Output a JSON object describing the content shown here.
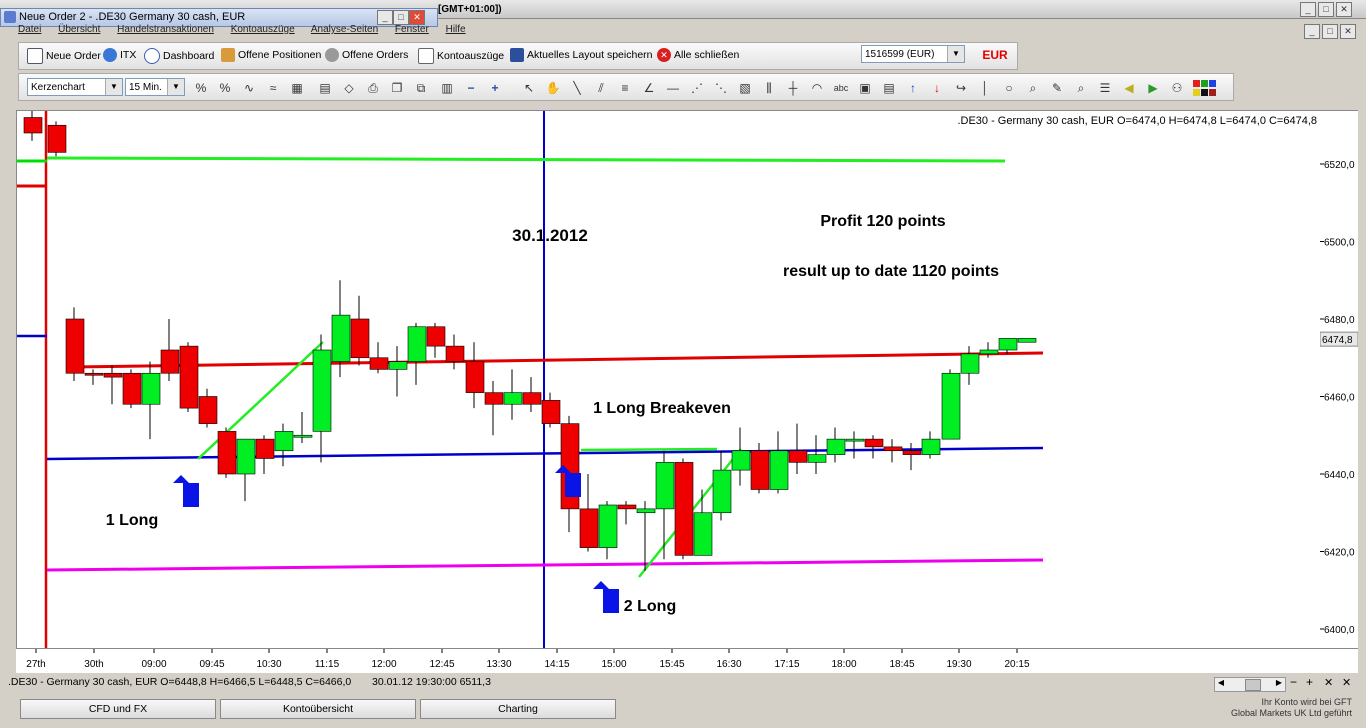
{
  "window": {
    "inner_title": "Neue Order 2 - .DE30 Germany 30 cash, EUR",
    "gmt": "[GMT+01:00])"
  },
  "menu": [
    "Datei",
    "Übersicht",
    "Handelstransaktionen",
    "Kontoauszüge",
    "Analyse-Seiten",
    "Fenster",
    "Hilfe"
  ],
  "toolbar": {
    "new_order": "Neue Order",
    "itx": "ITX",
    "dashboard": "Dashboard",
    "open_positions": "Offene Positionen",
    "open_orders": "Offene Orders",
    "statements": "Kontoauszüge",
    "save_layout": "Aktuelles Layout speichern",
    "close_all": "Alle schließen",
    "account": "1516599 (EUR)",
    "currency": "EUR"
  },
  "chart_toolbar": {
    "chart_type": "Kerzenchart",
    "interval": "15 Min."
  },
  "chart_data": {
    "type": "candlestick",
    "header": ".DE30 - Germany 30 cash, EUR O=6474,0 H=6474,8 L=6474,0 C=6474,8",
    "annotations": {
      "date": "30.1.2012",
      "profit": "Profit 120 points",
      "result": "result up to date 1120 points",
      "breakeven": "1 Long Breakeven",
      "long1": "1 Long",
      "long2": "2 Long"
    },
    "price_ticks": [
      "6520,0",
      "6500,0",
      "6480,0",
      "6460,0",
      "6440,0",
      "6420,0",
      "6400,0"
    ],
    "price_ticks_values": [
      6520,
      6500,
      6480,
      6460,
      6440,
      6420,
      6400
    ],
    "current_price": "6474,8",
    "ylim": [
      6395,
      6530
    ],
    "time_labels": [
      "27th",
      "30th",
      "09:00",
      "09:45",
      "10:30",
      "11:15",
      "12:00",
      "12:45",
      "13:30",
      "14:15",
      "15:00",
      "15:45",
      "16:30",
      "17:15",
      "18:00",
      "18:45",
      "19:30",
      "20:15"
    ],
    "candles": [
      {
        "o": 6532,
        "h": 6534,
        "l": 6526,
        "c": 6528
      },
      {
        "o": 6530,
        "h": 6531,
        "l": 6522,
        "c": 6523
      },
      {
        "o": 6480,
        "h": 6483,
        "l": 6464,
        "c": 6466
      },
      {
        "o": 6466,
        "h": 6467,
        "l": 6463,
        "c": 6465.5
      },
      {
        "o": 6466,
        "h": 6468,
        "l": 6458,
        "c": 6465
      },
      {
        "o": 6466,
        "h": 6467,
        "l": 6457,
        "c": 6458
      },
      {
        "o": 6458,
        "h": 6469,
        "l": 6449,
        "c": 6466
      },
      {
        "o": 6472,
        "h": 6480,
        "l": 6464,
        "c": 6466
      },
      {
        "o": 6473,
        "h": 6474,
        "l": 6456,
        "c": 6457
      },
      {
        "o": 6460,
        "h": 6462,
        "l": 6452,
        "c": 6453
      },
      {
        "o": 6451,
        "h": 6452,
        "l": 6439,
        "c": 6440
      },
      {
        "o": 6440,
        "h": 6446,
        "l": 6433,
        "c": 6449
      },
      {
        "o": 6449,
        "h": 6450,
        "l": 6440,
        "c": 6444
      },
      {
        "o": 6446,
        "h": 6453,
        "l": 6442,
        "c": 6451
      },
      {
        "o": 6450,
        "h": 6456,
        "l": 6448,
        "c": 6450
      },
      {
        "o": 6451,
        "h": 6476,
        "l": 6443,
        "c": 6472
      },
      {
        "o": 6469,
        "h": 6490,
        "l": 6465,
        "c": 6481
      },
      {
        "o": 6480,
        "h": 6486,
        "l": 6468,
        "c": 6470
      },
      {
        "o": 6470,
        "h": 6474,
        "l": 6466,
        "c": 6467
      },
      {
        "o": 6467,
        "h": 6473,
        "l": 6460,
        "c": 6469
      },
      {
        "o": 6469,
        "h": 6479,
        "l": 6463,
        "c": 6478
      },
      {
        "o": 6478,
        "h": 6479,
        "l": 6470,
        "c": 6473
      },
      {
        "o": 6473,
        "h": 6476,
        "l": 6467,
        "c": 6469
      },
      {
        "o": 6469,
        "h": 6474,
        "l": 6457,
        "c": 6461
      },
      {
        "o": 6461,
        "h": 6464,
        "l": 6450,
        "c": 6458
      },
      {
        "o": 6458,
        "h": 6467,
        "l": 6454,
        "c": 6461
      },
      {
        "o": 6461,
        "h": 6465,
        "l": 6456,
        "c": 6458
      },
      {
        "o": 6459,
        "h": 6461,
        "l": 6452,
        "c": 6453
      },
      {
        "o": 6453,
        "h": 6455,
        "l": 6425,
        "c": 6431
      },
      {
        "o": 6431,
        "h": 6440,
        "l": 6420,
        "c": 6421
      },
      {
        "o": 6421,
        "h": 6433,
        "l": 6418,
        "c": 6432
      },
      {
        "o": 6432,
        "h": 6433,
        "l": 6427,
        "c": 6431
      },
      {
        "o": 6430,
        "h": 6433,
        "l": 6415,
        "c": 6431
      },
      {
        "o": 6431,
        "h": 6446,
        "l": 6418,
        "c": 6443
      },
      {
        "o": 6443,
        "h": 6444,
        "l": 6418,
        "c": 6419
      },
      {
        "o": 6419,
        "h": 6436,
        "l": 6419,
        "c": 6430
      },
      {
        "o": 6430,
        "h": 6446,
        "l": 6428,
        "c": 6441
      },
      {
        "o": 6441,
        "h": 6452,
        "l": 6437,
        "c": 6446
      },
      {
        "o": 6446,
        "h": 6448,
        "l": 6435,
        "c": 6436
      },
      {
        "o": 6436,
        "h": 6451,
        "l": 6435,
        "c": 6446
      },
      {
        "o": 6446,
        "h": 6453,
        "l": 6440,
        "c": 6443
      },
      {
        "o": 6443,
        "h": 6450,
        "l": 6440,
        "c": 6445
      },
      {
        "o": 6445,
        "h": 6452,
        "l": 6443,
        "c": 6449
      },
      {
        "o": 6449,
        "h": 6451,
        "l": 6444,
        "c": 6449
      },
      {
        "o": 6449,
        "h": 6450,
        "l": 6444,
        "c": 6447
      },
      {
        "o": 6447,
        "h": 6449,
        "l": 6443,
        "c": 6446
      },
      {
        "o": 6446,
        "h": 6448,
        "l": 6441,
        "c": 6445
      },
      {
        "o": 6445,
        "h": 6451,
        "l": 6444,
        "c": 6449
      },
      {
        "o": 6449,
        "h": 6467,
        "l": 6449,
        "c": 6466
      },
      {
        "o": 6466,
        "h": 6473,
        "l": 6463,
        "c": 6471
      },
      {
        "o": 6471,
        "h": 6474,
        "l": 6470,
        "c": 6472
      },
      {
        "o": 6472,
        "h": 6475,
        "l": 6471,
        "c": 6475
      },
      {
        "o": 6474,
        "h": 6475,
        "l": 6474,
        "c": 6475
      }
    ],
    "colors": {
      "up": "#00ee22",
      "down": "#ee0000",
      "wick": "#000000"
    }
  },
  "status": {
    "info": ".DE30 - Germany 30 cash, EUR O=6448,8 H=6466,5 L=6448,5 C=6466,0",
    "timestamp": "30.01.12 19:30:00 6511,3"
  },
  "bottom_tabs": [
    "CFD und FX",
    "Kontoübersicht",
    "Charting"
  ],
  "footer": {
    "line1": "Ihr Konto wird bei GFT",
    "line2": "Global Markets UK Ltd geführt"
  }
}
